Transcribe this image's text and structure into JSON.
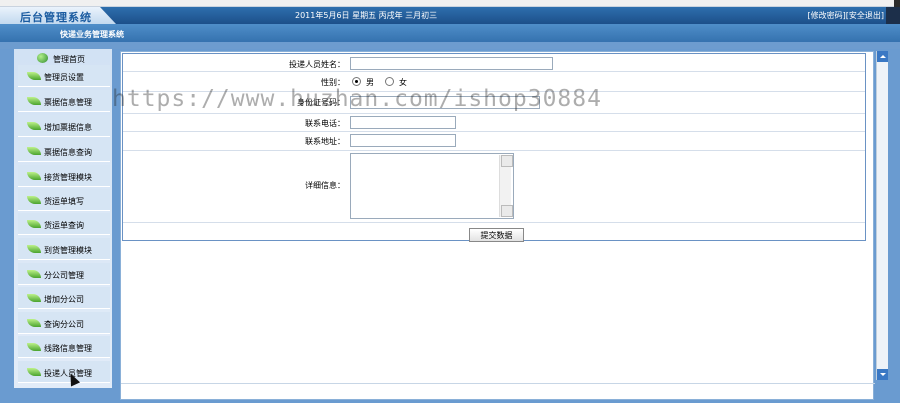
{
  "header": {
    "logo_text": "后台管理系统",
    "date_line": "2011年5月6日  星期五  丙戌年  三月初三",
    "links": {
      "change_password": "[修改密码]",
      "logout": "[安全退出]"
    }
  },
  "system_title": "快递业务管理系统",
  "sidebar": {
    "home_label": "管理首页",
    "items": [
      {
        "label": "管理员设置"
      },
      {
        "label": "票据信息管理"
      },
      {
        "label": "增加票据信息"
      },
      {
        "label": "票据信息查询"
      },
      {
        "label": "接货管理模块"
      },
      {
        "label": "货运单填写"
      },
      {
        "label": "货运单查询"
      },
      {
        "label": "到货管理模块"
      },
      {
        "label": "分公司管理"
      },
      {
        "label": "增加分公司"
      },
      {
        "label": "查询分公司"
      },
      {
        "label": "线路信息管理"
      },
      {
        "label": "投递人员管理"
      }
    ]
  },
  "form": {
    "name_label": "投递人员姓名：",
    "gender_label": "性别：",
    "gender_options": {
      "male": "男",
      "female": "女"
    },
    "gender_selected": "男",
    "id_label": "身份证号码：",
    "phone_label": "联系电话：",
    "address_label": "联系地址：",
    "detail_label": "详细信息：",
    "submit_label": "提交数据"
  },
  "watermark": "https://www.huzhan.com/ishop30884",
  "colors": {
    "header": "#2e6fad",
    "sidebar": "#6a9bd0",
    "accent": "#3a78c4"
  }
}
